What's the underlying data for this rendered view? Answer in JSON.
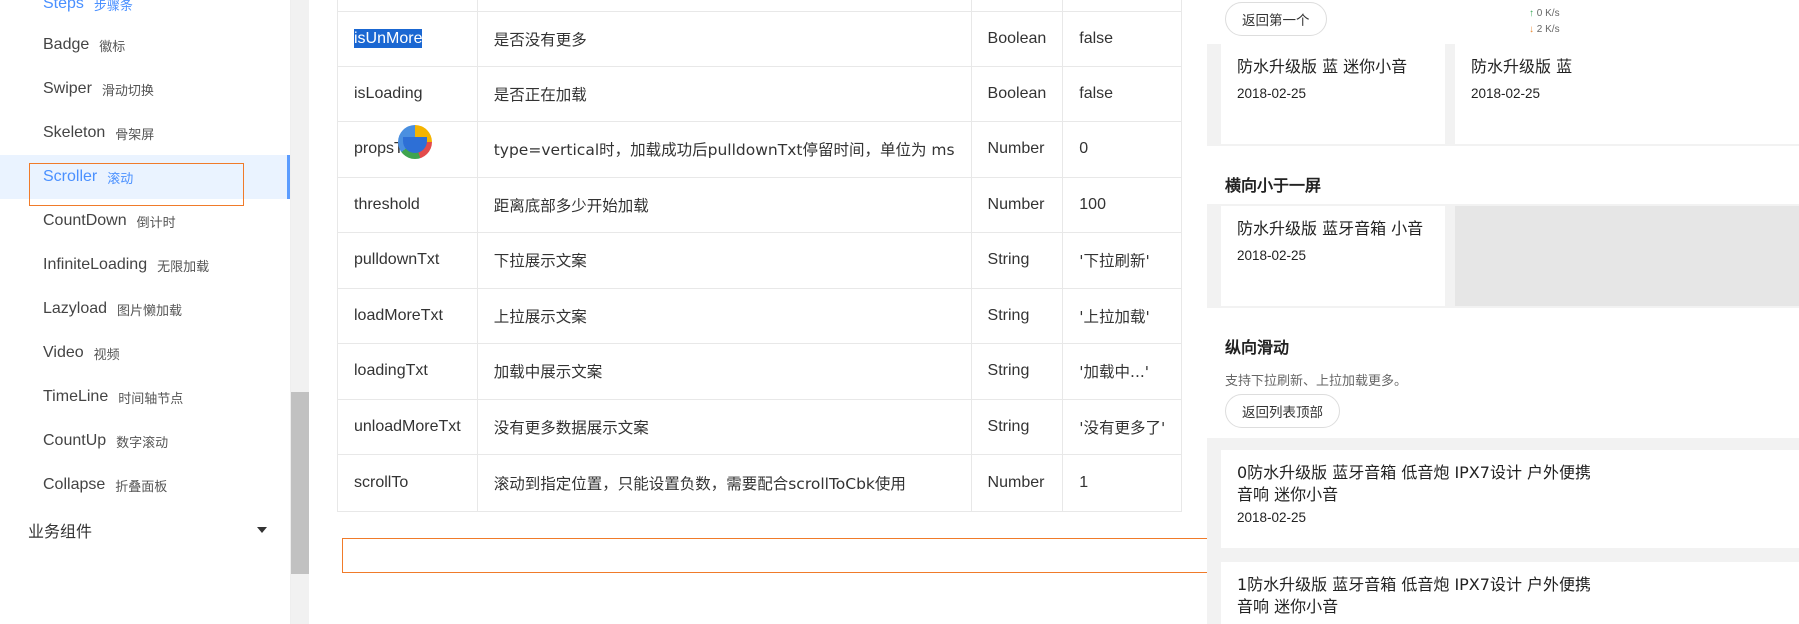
{
  "sidebar": {
    "items": [
      {
        "en": "Steps",
        "cn": "步骤条"
      },
      {
        "en": "Badge",
        "cn": "徽标"
      },
      {
        "en": "Swiper",
        "cn": "滑动切换"
      },
      {
        "en": "Skeleton",
        "cn": "骨架屏"
      },
      {
        "en": "Scroller",
        "cn": "滚动"
      },
      {
        "en": "CountDown",
        "cn": "倒计时"
      },
      {
        "en": "InfiniteLoading",
        "cn": "无限加载"
      },
      {
        "en": "Lazyload",
        "cn": "图片懒加载"
      },
      {
        "en": "Video",
        "cn": "视频"
      },
      {
        "en": "TimeLine",
        "cn": "时间轴节点"
      },
      {
        "en": "CountUp",
        "cn": "数字滚动"
      },
      {
        "en": "Collapse",
        "cn": "折叠面板"
      }
    ],
    "group": "业务组件"
  },
  "table": {
    "rows": [
      {
        "name": "",
        "desc": "",
        "type": "",
        "default": ""
      },
      {
        "name": "isUnMore",
        "desc": "是否没有更多",
        "type": "Boolean",
        "default": "false"
      },
      {
        "name": "isLoading",
        "desc": "是否正在加载",
        "type": "Boolean",
        "default": "false"
      },
      {
        "name": "propsTim",
        "desc": "type=vertical时，加载成功后pulldownTxt停留时间，单位为 ms",
        "type": "Number",
        "default": "0"
      },
      {
        "name": "threshold",
        "desc": "距离底部多少开始加载",
        "type": "Number",
        "default": "100"
      },
      {
        "name": "pulldownTxt",
        "desc": "下拉展示文案",
        "type": "String",
        "default": "'下拉刷新'"
      },
      {
        "name": "loadMoreTxt",
        "desc": "上拉展示文案",
        "type": "String",
        "default": "'上拉加载'"
      },
      {
        "name": "loadingTxt",
        "desc": "加载中展示文案",
        "type": "String",
        "default": "'加载中...'"
      },
      {
        "name": "unloadMoreTxt",
        "desc": "没有更多数据展示文案",
        "type": "String",
        "default": "'没有更多了'"
      },
      {
        "name": "scrollTo",
        "desc": "滚动到指定位置，只能设置负数，需要配合scrollToCbk使用",
        "type": "Number",
        "default": "1"
      }
    ]
  },
  "preview": {
    "back_first_btn": "返回第一个",
    "card1_title": "防水升级版 蓝 迷你小音",
    "card1_date": "2018-02-25",
    "card2_title": "防水升级版 蓝",
    "card2_date": "2018-02-25",
    "section_horizontal_small": "横向小于一屏",
    "card3_title": "防水升级版 蓝牙音箱 小音",
    "card3_date": "2018-02-25",
    "section_vertical": "纵向滑动",
    "vertical_desc": "支持下拉刷新、上拉加载更多。",
    "back_top_btn": "返回列表顶部",
    "card4_title_line1": "0防水升级版 蓝牙音箱 低音炮 IPX7设计 户外便携",
    "card4_title_line2": "音响 迷你小音",
    "card4_date": "2018-02-25",
    "card5_title_line1": "1防水升级版 蓝牙音箱 低音炮 IPX7设计 户外便携",
    "card5_title_line2": "音响 迷你小音"
  },
  "speed": {
    "up": "0",
    "down": "2",
    "unit": "K/s"
  },
  "colors": {
    "accent": "#4a90ff",
    "highlight_box": "#f07b2a",
    "selection": "#1a67d2"
  }
}
